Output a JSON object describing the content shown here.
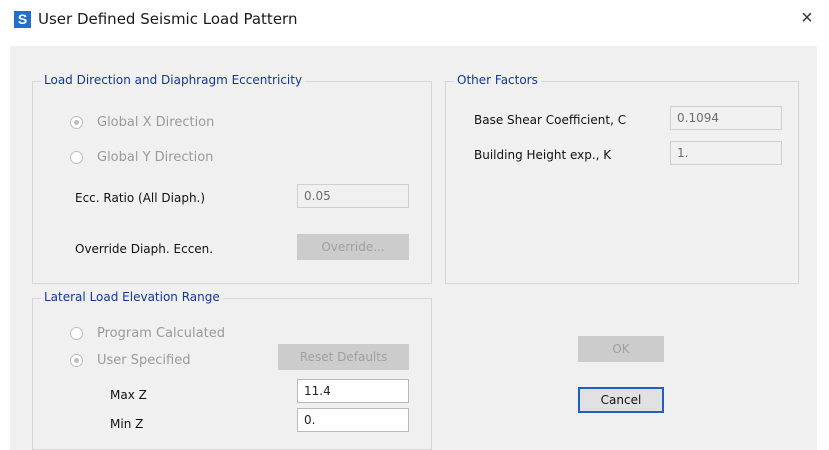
{
  "window": {
    "title": "User Defined Seismic Load Pattern",
    "app_icon_letter": "S",
    "close_glyph": "×"
  },
  "load_direction": {
    "legend": "Load Direction and Diaphragm Eccentricity",
    "radio_x": "Global  X  Direction",
    "radio_y": "Global  Y  Direction",
    "ecc_label": "Ecc. Ratio (All Diaph.)",
    "ecc_value": "0.05",
    "override_label": "Override Diaph. Eccen.",
    "override_button": "Override..."
  },
  "other_factors": {
    "legend": "Other Factors",
    "base_shear_label": "Base Shear Coefficient, C",
    "base_shear_value": "0.1094",
    "height_exp_label": "Building Height exp., K",
    "height_exp_value": "1."
  },
  "elevation_range": {
    "legend": "Lateral Load Elevation Range",
    "radio_program": "Program Calculated",
    "radio_user": "User Specified",
    "reset_button": "Reset Defaults",
    "max_z_label": "Max Z",
    "max_z_value": "11.4",
    "min_z_label": "Min Z",
    "min_z_value": "0."
  },
  "buttons": {
    "ok": "OK",
    "cancel": "Cancel"
  },
  "colors": {
    "legend_text": "#12369f",
    "default_button_border": "#1f5fbf",
    "app_icon": "#1f6fd1"
  }
}
